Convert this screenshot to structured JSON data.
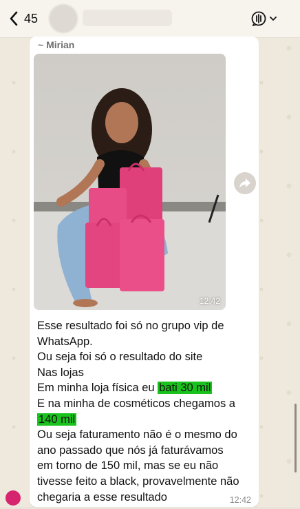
{
  "header": {
    "back_count": "45"
  },
  "message": {
    "sender": "~ Mirian",
    "photo_time": "12:42",
    "lines": [
      {
        "pre": "Esse resultado foi só no grupo vip de",
        "hl": "",
        "post": ""
      },
      {
        "pre": "WhatsApp.",
        "hl": "",
        "post": ""
      },
      {
        "pre": "Ou seja foi só o resultado do site",
        "hl": "",
        "post": ""
      },
      {
        "pre": "Nas lojas",
        "hl": "",
        "post": ""
      },
      {
        "pre": "Em minha loja física eu ",
        "hl": "bati 30 mil",
        "post": ""
      },
      {
        "pre": "E na minha de cosméticos chegamos a",
        "hl": "",
        "post": ""
      },
      {
        "pre": "",
        "hl": "140 mil",
        "post": ""
      },
      {
        "pre": "Ou seja faturamento não é o mesmo do",
        "hl": "",
        "post": ""
      },
      {
        "pre": "ano passado que nós já faturávamos",
        "hl": "",
        "post": ""
      },
      {
        "pre": "em torno de 150 mil, mas se eu não",
        "hl": "",
        "post": ""
      },
      {
        "pre": "tivesse feito a black, provavelmente não",
        "hl": "",
        "post": ""
      },
      {
        "pre": "chegaria a esse resultado",
        "hl": "",
        "post": ""
      }
    ],
    "time": "12:42"
  },
  "colors": {
    "highlight": "#19c21c",
    "bubble": "#ffffff",
    "wallpaper": "#efe8dd"
  },
  "icons": {
    "back": "chevron-left-icon",
    "call": "call-waveform-icon",
    "forward": "forward-arrow-icon"
  }
}
